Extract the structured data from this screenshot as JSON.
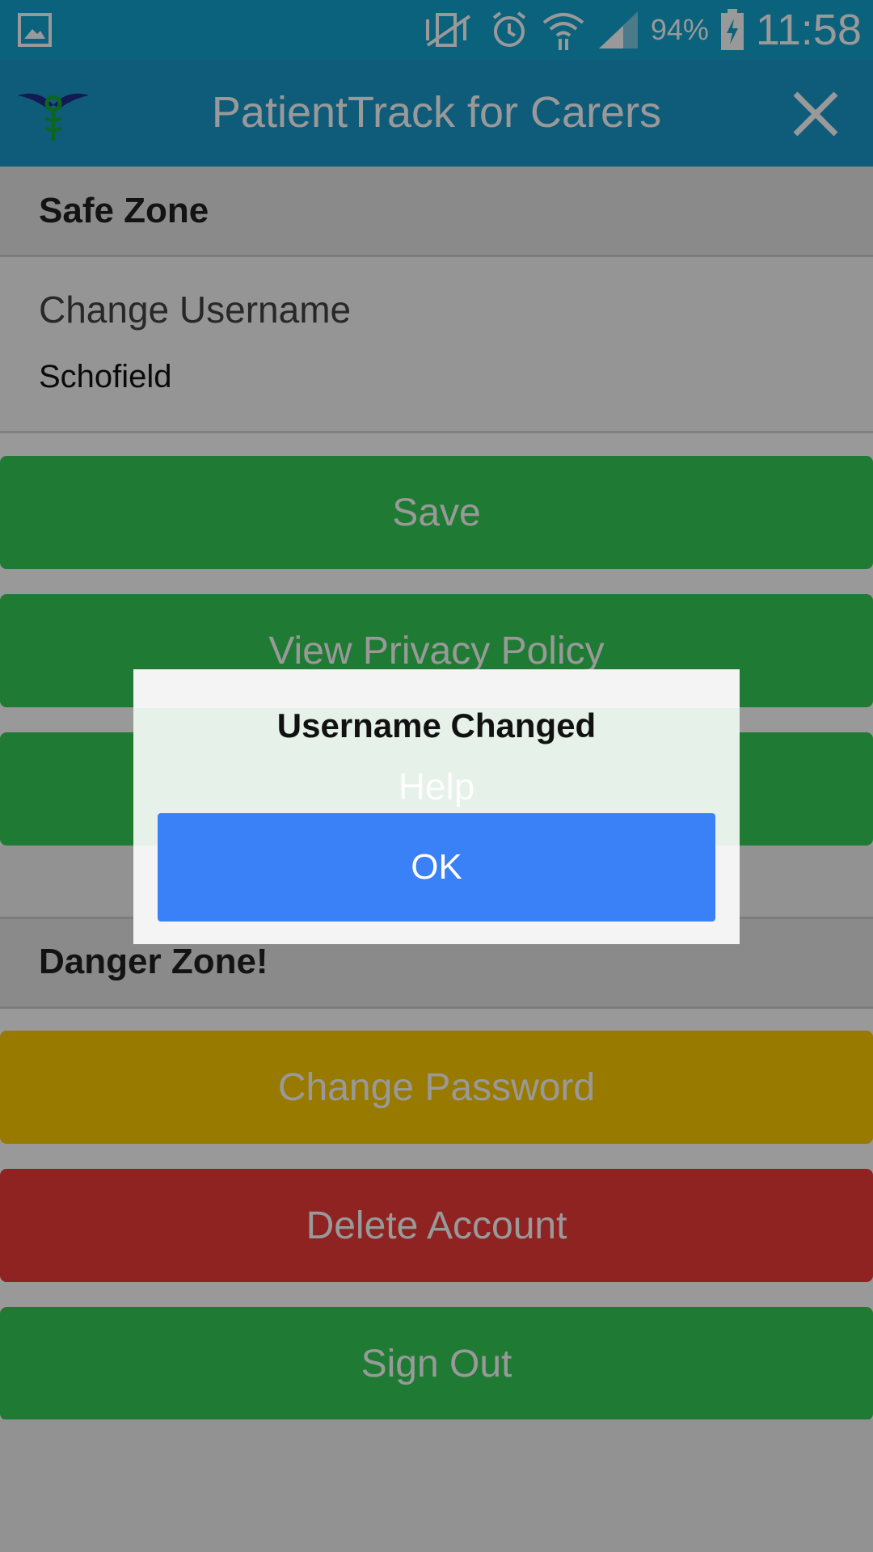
{
  "status_bar": {
    "battery": "94%",
    "time": "11:58"
  },
  "header": {
    "title": "PatientTrack for Carers"
  },
  "safe_zone": {
    "title": "Safe Zone",
    "username_label": "Change Username",
    "username_value": "Schofield",
    "save": "Save",
    "privacy": "View Privacy Policy",
    "help": "Help"
  },
  "danger_zone": {
    "title": "Danger Zone!",
    "change_password": "Change Password",
    "delete_account": "Delete Account",
    "sign_out": "Sign Out"
  },
  "dialog": {
    "message": "Username Changed",
    "ok": "OK"
  },
  "colors": {
    "status_bar": "#13a3cf",
    "header": "#1a99cc",
    "green_button": "#35ce55",
    "yellow_button": "#ffcc00",
    "red_button": "#ef3b3a",
    "dialog_ok": "#3a80f6"
  },
  "icons": {
    "status_left": "gallery-icon",
    "status_right": [
      "vibrate-icon",
      "alarm-icon",
      "wifi-icon",
      "signal-icon",
      "battery-charging-icon"
    ],
    "logo": "caduceus-logo",
    "close": "close-icon"
  }
}
